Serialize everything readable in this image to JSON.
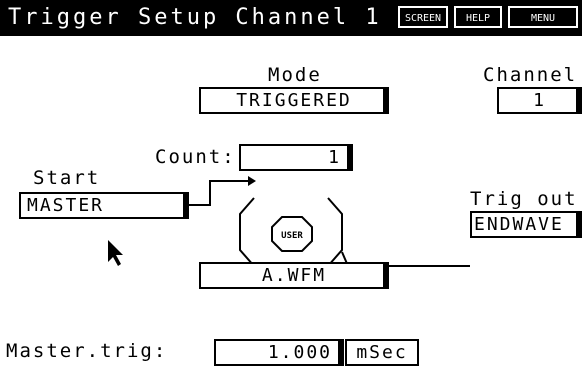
{
  "window": {
    "title": "Trigger Setup Channel 1",
    "buttons": {
      "screen": "SCREEN",
      "help": "HELP",
      "menu": "MENU"
    }
  },
  "mode": {
    "label": "Mode",
    "value": "TRIGGERED"
  },
  "channel": {
    "label": "Channel",
    "value": "1"
  },
  "count": {
    "label": "Count:",
    "value": "1"
  },
  "start": {
    "label": "Start",
    "value": "MASTER"
  },
  "trig_out": {
    "label": "Trig out",
    "value": "ENDWAVE"
  },
  "user_block": {
    "label": "USER"
  },
  "waveform": {
    "value": "A.WFM"
  },
  "master_trig": {
    "label": "Master.trig:",
    "value": "1.000",
    "unit": "mSec"
  }
}
